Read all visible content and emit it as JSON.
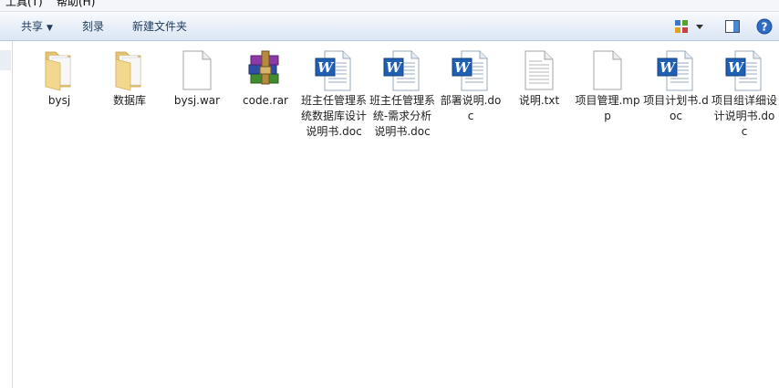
{
  "menubar": {
    "items": [
      {
        "label": "工具(T)"
      },
      {
        "label": "帮助(H)"
      }
    ]
  },
  "toolbar": {
    "share_label": "共享",
    "burn_label": "刻录",
    "new_folder_label": "新建文件夹"
  },
  "files": [
    {
      "label": "bysj",
      "type": "folder"
    },
    {
      "label": "数据库",
      "type": "folder"
    },
    {
      "label": "bysj.war",
      "type": "blank"
    },
    {
      "label": "code.rar",
      "type": "rar"
    },
    {
      "label": "班主任管理系统数据库设计说明书.doc",
      "type": "word"
    },
    {
      "label": "班主任管理系统-需求分析说明书.doc",
      "type": "word"
    },
    {
      "label": "部署说明.doc",
      "type": "word"
    },
    {
      "label": "说明.txt",
      "type": "txt"
    },
    {
      "label": "项目管理.mpp",
      "type": "blank"
    },
    {
      "label": "项目计划书.doc",
      "type": "word"
    },
    {
      "label": "项目组详细设计说明书.doc",
      "type": "word"
    }
  ],
  "icons": {
    "folder": "folder-icon",
    "blank": "blank-file-icon",
    "rar": "winrar-archive-icon",
    "word": "word-document-icon",
    "txt": "text-file-icon"
  }
}
